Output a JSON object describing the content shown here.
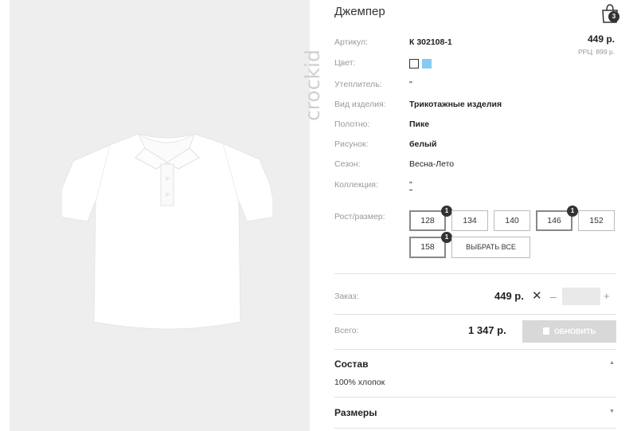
{
  "product": {
    "title": "Джемпер",
    "brand": "crockid",
    "price": "449 р.",
    "rrp": "РРЦ: 899 р."
  },
  "cart": {
    "count": "3",
    "icon": "shopping-bag-icon"
  },
  "details": [
    {
      "label": "Артикул:",
      "value": "К 302108-1",
      "bold": true
    },
    {
      "label": "Цвет:",
      "value": ""
    },
    {
      "label": "Утеплитель:",
      "value": "\""
    },
    {
      "label": "Вид изделия:",
      "value": "Трикотажные изделия",
      "bold": true
    },
    {
      "label": "Полотно:",
      "value": "Пике",
      "bold": true
    },
    {
      "label": "Рисунок:",
      "value": "белый",
      "bold": true
    },
    {
      "label": "Сезон:",
      "value": "Весна-Лето"
    },
    {
      "label": "Коллекция:",
      "value": "\""
    }
  ],
  "colors": [
    {
      "name": "white",
      "hex": "#ffffff",
      "selected": true
    },
    {
      "name": "light-blue",
      "hex": "#88c9f2",
      "selected": false
    }
  ],
  "sizes": {
    "label": "Рост/размер:",
    "options": [
      {
        "value": "128",
        "selected": true,
        "count": "1"
      },
      {
        "value": "134",
        "selected": false
      },
      {
        "value": "140",
        "selected": false
      },
      {
        "value": "146",
        "selected": true,
        "count": "1"
      },
      {
        "value": "152",
        "selected": false
      },
      {
        "value": "158",
        "selected": true,
        "count": "1"
      }
    ],
    "select_all": "ВЫБРАТЬ ВСЕ"
  },
  "order": {
    "label": "Заказ:",
    "price": "449 р.",
    "times": "✕",
    "minus": "–",
    "plus": "+",
    "quantity": ""
  },
  "total": {
    "label": "Всего:",
    "value": "1 347 р.",
    "update_label": "ОБНОВИТЬ"
  },
  "accordion": {
    "composition_title": "Состав",
    "composition_text": "100% хлопок",
    "sizes_title": "Размеры",
    "arrow_up": "▲",
    "arrow_down": "▼"
  }
}
